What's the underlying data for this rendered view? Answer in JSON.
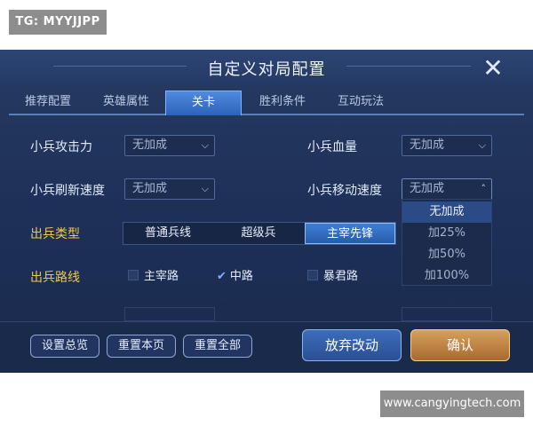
{
  "watermarks": {
    "top_left": "TG: MYYJJPP",
    "bottom_right": "www.cangyingtech.com"
  },
  "dialog": {
    "title": "自定义对局配置",
    "close_glyph": "✕"
  },
  "tabs": [
    {
      "label": "推荐配置"
    },
    {
      "label": "英雄属性"
    },
    {
      "label": "关卡"
    },
    {
      "label": "胜利条件"
    },
    {
      "label": "互动玩法"
    }
  ],
  "rows": {
    "attack": {
      "label": "小兵攻击力",
      "value": "无加成"
    },
    "hp": {
      "label": "小兵血量",
      "value": "无加成"
    },
    "refresh": {
      "label": "小兵刷新速度",
      "value": "无加成"
    },
    "move": {
      "label": "小兵移动速度",
      "value": "无加成"
    }
  },
  "minion_type": {
    "label": "出兵类型",
    "options": [
      "普通兵线",
      "超级兵",
      "主宰先锋"
    ],
    "selected": "主宰先锋"
  },
  "minion_lane": {
    "label": "出兵路线",
    "options": [
      {
        "label": "主宰路",
        "checked": false
      },
      {
        "label": "中路",
        "checked": true
      },
      {
        "label": "暴君路",
        "checked": false
      }
    ],
    "check_glyph": "✔"
  },
  "dropdown_menu": {
    "items": [
      "无加成",
      "加25%",
      "加50%",
      "加100%"
    ],
    "selected": "无加成"
  },
  "footer": {
    "overview": "设置总览",
    "reset_page": "重置本页",
    "reset_all": "重置全部",
    "discard": "放弃改动",
    "confirm": "确认"
  },
  "colors": {
    "active_tab": "#3a77d0",
    "gold_label": "#f0c94a",
    "confirm_button": "#c1874a"
  }
}
